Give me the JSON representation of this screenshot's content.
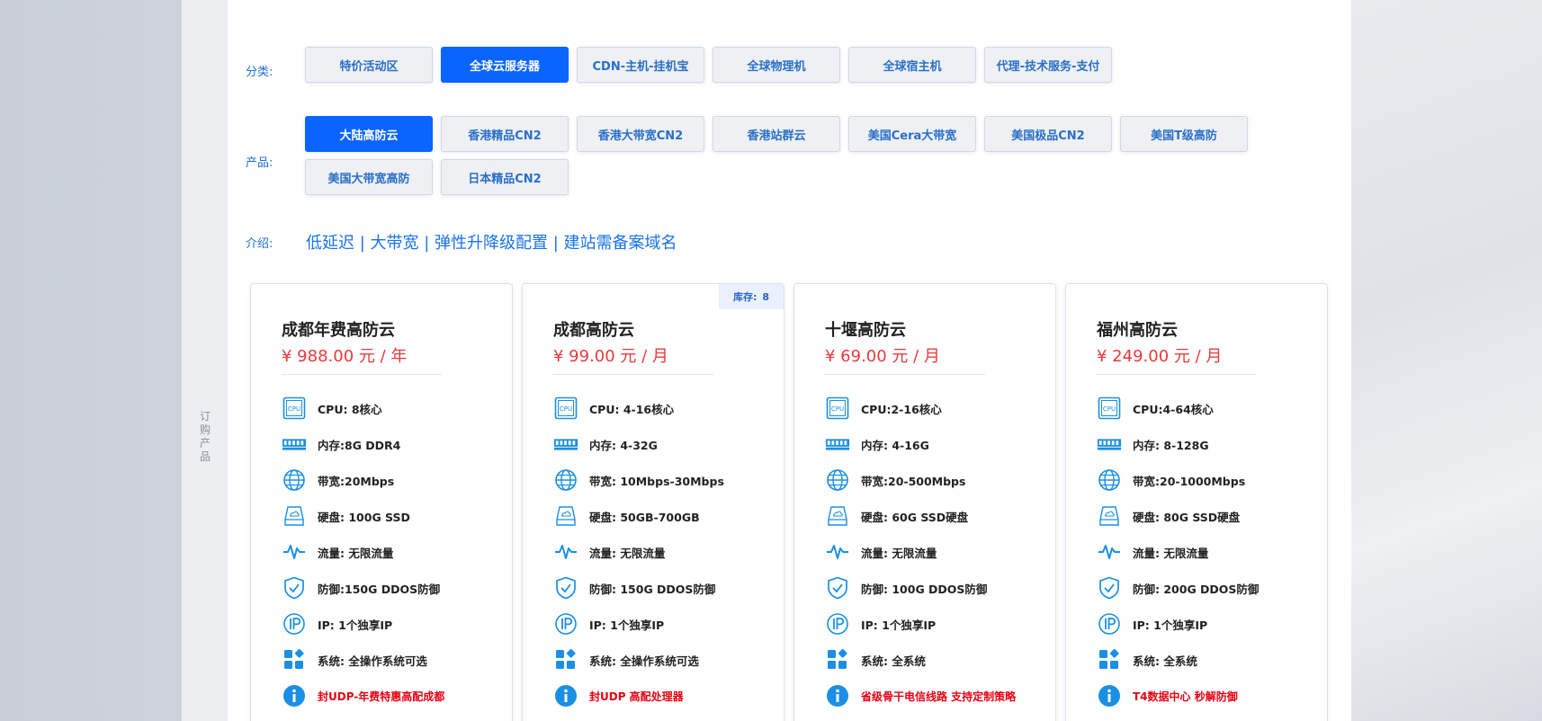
{
  "sidebar": {
    "label": "订购产品"
  },
  "category": {
    "label": "分类:",
    "items": [
      "特价活动区",
      "全球云服务器",
      "CDN-主机-挂机宝",
      "全球物理机",
      "全球宿主机",
      "代理-技术服务-支付"
    ],
    "active_index": 1
  },
  "product": {
    "label": "产品:",
    "items": [
      "大陆高防云",
      "香港精品CN2",
      "香港大带宽CN2",
      "香港站群云",
      "美国Cera大带宽",
      "美国极品CN2",
      "美国T级高防",
      "美国大带宽高防",
      "日本精品CN2"
    ],
    "active_index": 0
  },
  "intro": {
    "label": "介绍:",
    "text": "低延迟 | 大带宽 | 弹性升降级配置 | 建站需备案域名"
  },
  "colors": {
    "accent": "#0a64ff",
    "price": "#e9393b",
    "note": "#e60012",
    "icon": "#1a8fe3"
  },
  "cards": [
    {
      "title": "成都年费高防云",
      "price": "¥ 988.00 元 / 年",
      "specs": {
        "cpu": "CPU: 8核心",
        "memory": "内存:8G DDR4",
        "bandwidth": "带宽:20Mbps",
        "disk": "硬盘: 100G SSD",
        "traffic": "流量:  无限流量",
        "defense": "防御:150G DDOS防御",
        "ip": "IP: 1个独享IP",
        "os": "系统: 全操作系统可选",
        "note": "封UDP-年费特惠高配成都"
      }
    },
    {
      "title": "成都高防云",
      "price": "¥ 99.00 元 / 月",
      "stock_label": "库存:",
      "stock_value": "8",
      "specs": {
        "cpu": "CPU: 4-16核心",
        "memory": "内存: 4-32G",
        "bandwidth": "带宽: 10Mbps-30Mbps",
        "disk": "硬盘: 50GB-700GB",
        "traffic": "流量:  无限流量",
        "defense": "防御: 150G DDOS防御",
        "ip": "IP: 1个独享IP",
        "os": "系统: 全操作系统可选",
        "note": "封UDP 高配处理器"
      }
    },
    {
      "title": "十堰高防云",
      "price": "¥ 69.00 元 / 月",
      "specs": {
        "cpu": "CPU:2-16核心",
        "memory": "内存: 4-16G",
        "bandwidth": "带宽:20-500Mbps",
        "disk": "硬盘: 60G SSD硬盘",
        "traffic": "流量: 无限流量",
        "defense": "防御: 100G DDOS防御",
        "ip": "IP: 1个独享IP",
        "os": "系统: 全系统",
        "note": "省级骨干电信线路 支持定制策略"
      }
    },
    {
      "title": "福州高防云",
      "price": "¥ 249.00 元 / 月",
      "specs": {
        "cpu": "CPU:4-64核心",
        "memory": "内存: 8-128G",
        "bandwidth": "带宽:20-1000Mbps",
        "disk": "硬盘: 80G SSD硬盘",
        "traffic": "流量: 无限流量",
        "defense": "防御: 200G DDOS防御",
        "ip": "IP: 1个独享IP",
        "os": "系统: 全系统",
        "note": "T4数据中心 秒解防御"
      }
    }
  ]
}
